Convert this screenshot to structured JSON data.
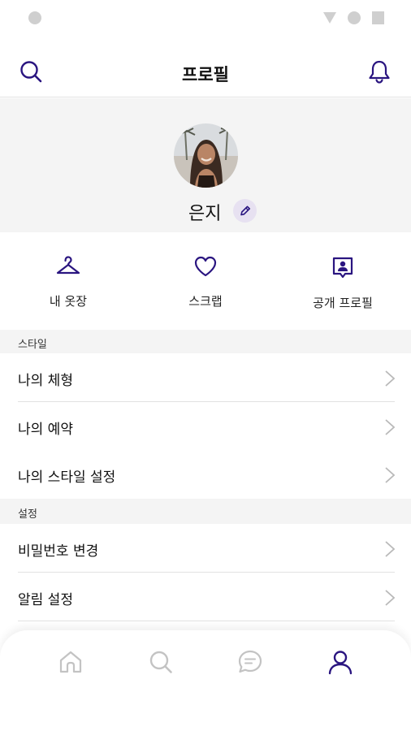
{
  "app": {
    "title": "프로필"
  },
  "colors": {
    "accent": "#2a1580",
    "inactive": "#c3c3c3",
    "edit_bg": "#e7e1f1"
  },
  "header": {
    "left_icon": "search-icon",
    "title": "프로필",
    "right_icon": "bell-icon"
  },
  "profile": {
    "name": "은지",
    "edit_icon": "pencil-icon"
  },
  "quick_actions": [
    {
      "label": "내 옷장",
      "icon": "hanger-icon"
    },
    {
      "label": "스크랩",
      "icon": "heart-icon"
    },
    {
      "label": "공개 프로필",
      "icon": "profile-card-icon"
    }
  ],
  "sections": {
    "style": {
      "title": "스타일",
      "items": [
        {
          "label": "나의 체형"
        },
        {
          "label": "나의 예약"
        },
        {
          "label": "나의 스타일 설정"
        }
      ]
    },
    "settings": {
      "title": "설정",
      "items": [
        {
          "label": "비밀번호 변경"
        },
        {
          "label": "알림 설정"
        }
      ]
    }
  },
  "bottom_nav": [
    {
      "name": "home",
      "icon": "home-icon",
      "active": false
    },
    {
      "name": "search",
      "icon": "search-icon",
      "active": false
    },
    {
      "name": "chat",
      "icon": "chat-icon",
      "active": false
    },
    {
      "name": "profile",
      "icon": "user-icon",
      "active": true
    }
  ]
}
